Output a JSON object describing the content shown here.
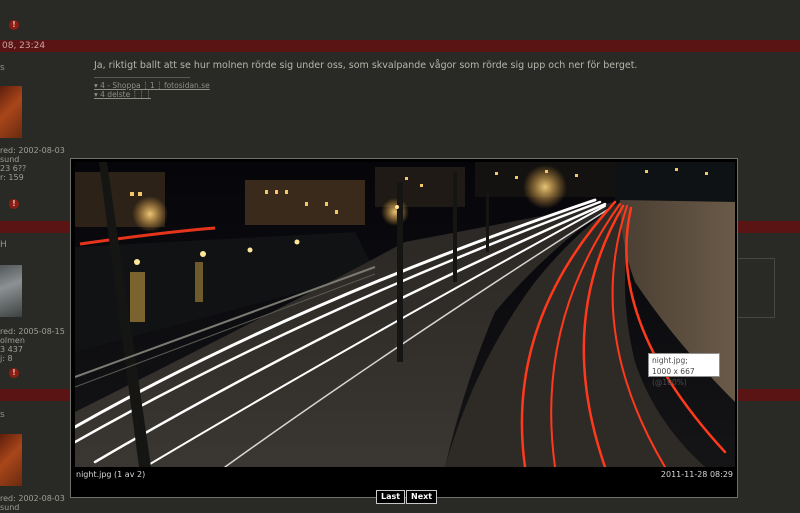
{
  "forum": {
    "bars": [
      {
        "label": ""
      },
      {
        "label": "08, 23:24"
      },
      {
        "label": ""
      },
      {
        "label": ""
      },
      {
        "label": ""
      }
    ],
    "post_text": "Ja, riktigt ballt att se hur molnen rörde sig under oss, som skvalpande vågor som rörde sig upp och ner för berget.",
    "sig_line1": "▾ 4 - Shoppa ┊ 1 ┊ fotosidan.se",
    "sig_line2": "▾ 4 delste ┊ ┊ ┊",
    "user1_info": "red: 2002-08-03\nsund\n23 6??\nr: 159",
    "user2_info": "red: 2005-08-15\nolmen\n3 437\nj: 8",
    "user3_info": "red: 2002-08-03\nsund",
    "letter_a": "s",
    "letter_b": "H",
    "letter_c": "s"
  },
  "lightbox": {
    "filename_caption": "night.jpg (1 av 2)",
    "timestamp": "2011-11-28 08:29",
    "tooltip_name": "night.jpg;",
    "tooltip_size": "1000 x 667 (@100%)",
    "last_button": "Last",
    "next_button": "Next",
    "photo_description": "night.jpg"
  },
  "colors": {
    "page_bg": "#292a26",
    "bar_red": "#5a1413",
    "light_trail_red": "#ff3a1c",
    "light_trail_white": "#ffffff"
  }
}
